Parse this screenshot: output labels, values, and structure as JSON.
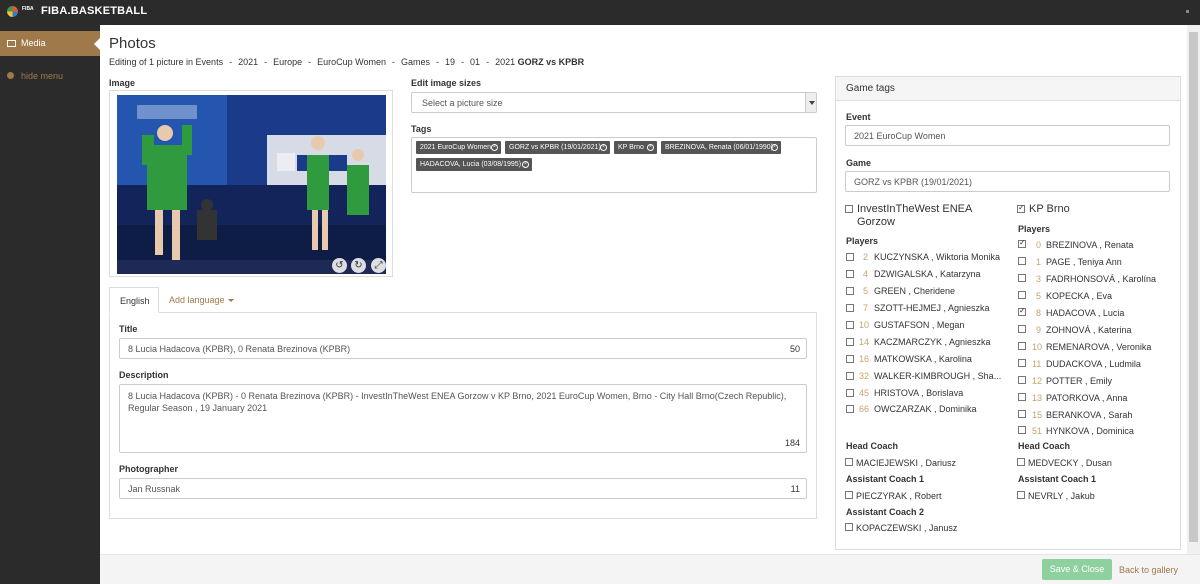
{
  "app": {
    "brand": "FIBA.BASKETBALL",
    "logo_small": "FIBA"
  },
  "sidebar": {
    "items": [
      {
        "label": "Media",
        "icon": "image-icon",
        "active": true
      },
      {
        "label": "hide menu",
        "icon": "circle-arrow-icon"
      }
    ]
  },
  "page": {
    "title": "Photos",
    "breadcrumb": [
      "Editing of 1 picture in Events",
      "2021",
      "Europe",
      "EuroCup Women",
      "Games",
      "19",
      "01",
      "2021"
    ],
    "breadcrumb_bold": "GORZ vs KPBR"
  },
  "image_section": {
    "label": "Image"
  },
  "sizes": {
    "label": "Edit image sizes",
    "placeholder": "Select a picture size"
  },
  "tags": {
    "label": "Tags",
    "items": [
      "2021 EuroCup Women",
      "GORZ vs KPBR (19/01/2021)",
      "KP Brno",
      "BREZINOVA, Renata (06/01/1990)",
      "HADACOVA, Lucia (03/08/1995)"
    ]
  },
  "lang_tabs": {
    "active": "English",
    "add": "Add language"
  },
  "form": {
    "title_label": "Title",
    "title_value": "8 Lucia Hadacova (KPBR), 0 Renata Brezinova (KPBR)",
    "title_count": "50",
    "desc_label": "Description",
    "desc_value": "8 Lucia Hadacova (KPBR) - 0 Renata Brezinova (KPBR) - InvestInTheWest ENEA Gorzow v KP Brno, 2021 EuroCup Women, Brno - City Hall Brno(Czech Republic), Regular Season , 19 January 2021",
    "desc_count": "184",
    "photographer_label": "Photographer",
    "photographer_value": "Jan Russnak",
    "photographer_count": "11"
  },
  "game_tags": {
    "header": "Game tags",
    "event_label": "Event",
    "event_value": "2021 EuroCup Women",
    "game_label": "Game",
    "game_value": "GORZ vs KPBR (19/01/2021)",
    "teams": [
      {
        "name": "InvestInTheWest ENEA Gorzow",
        "checked": false,
        "players_label": "Players",
        "players": [
          {
            "num": "2",
            "name": "KUCZYNSKA , Wiktoria Monika",
            "checked": false
          },
          {
            "num": "4",
            "name": "DZWIGALSKA , Katarzyna",
            "checked": false
          },
          {
            "num": "5",
            "name": "GREEN , Cheridene",
            "checked": false
          },
          {
            "num": "7",
            "name": "SZOTT-HEJMEJ , Agnieszka",
            "checked": false
          },
          {
            "num": "10",
            "name": "GUSTAFSON , Megan",
            "checked": false
          },
          {
            "num": "14",
            "name": "KACZMARCZYK , Agnieszka",
            "checked": false
          },
          {
            "num": "16",
            "name": "MATKOWSKA , Karolina",
            "checked": false
          },
          {
            "num": "32",
            "name": "WALKER-KIMBROUGH , Sha...",
            "checked": false
          },
          {
            "num": "45",
            "name": "HRISTOVA , Borislava",
            "checked": false
          },
          {
            "num": "66",
            "name": "OWCZARZAK , Dominika",
            "checked": false
          }
        ],
        "head_coach_label": "Head Coach",
        "head_coach": "MACIEJEWSKI , Dariusz",
        "ac1_label": "Assistant Coach 1",
        "ac1": "PIECZYRAK , Robert",
        "ac2_label": "Assistant Coach 2",
        "ac2": "KOPACZEWSKI , Janusz"
      },
      {
        "name": "KP Brno",
        "checked": true,
        "players_label": "Players",
        "players": [
          {
            "num": "0",
            "name": "BREZINOVA , Renata",
            "checked": true
          },
          {
            "num": "1",
            "name": "PAGE , Teniya Ann",
            "checked": false
          },
          {
            "num": "3",
            "name": "FADRHONSOVÁ , Karolína",
            "checked": false
          },
          {
            "num": "5",
            "name": "KOPECKA , Eva",
            "checked": false
          },
          {
            "num": "8",
            "name": "HADACOVA , Lucia",
            "checked": true
          },
          {
            "num": "9",
            "name": "ZOHNOVÁ , Katerina",
            "checked": false
          },
          {
            "num": "10",
            "name": "REMENAROVA , Veronika",
            "checked": false
          },
          {
            "num": "11",
            "name": "DUDACKOVA , Ludmila",
            "checked": false
          },
          {
            "num": "12",
            "name": "POTTER , Emily",
            "checked": false
          },
          {
            "num": "13",
            "name": "PATORKOVA , Anna",
            "checked": false
          },
          {
            "num": "15",
            "name": "BERANKOVA , Sarah",
            "checked": false
          },
          {
            "num": "51",
            "name": "HYNKOVA , Dominica",
            "checked": false
          }
        ],
        "head_coach_label": "Head Coach",
        "head_coach": "MEDVECKY , Dusan",
        "ac1_label": "Assistant Coach 1",
        "ac1": "NEVRLY , Jakub"
      }
    ]
  },
  "footer": {
    "save": "Save & Close",
    "back": "Back to gallery"
  },
  "colors": {
    "accent": "#a0794a",
    "dark": "#2b2b2b",
    "save_green": "#8fd19e",
    "number_gold": "#c9a26b"
  }
}
